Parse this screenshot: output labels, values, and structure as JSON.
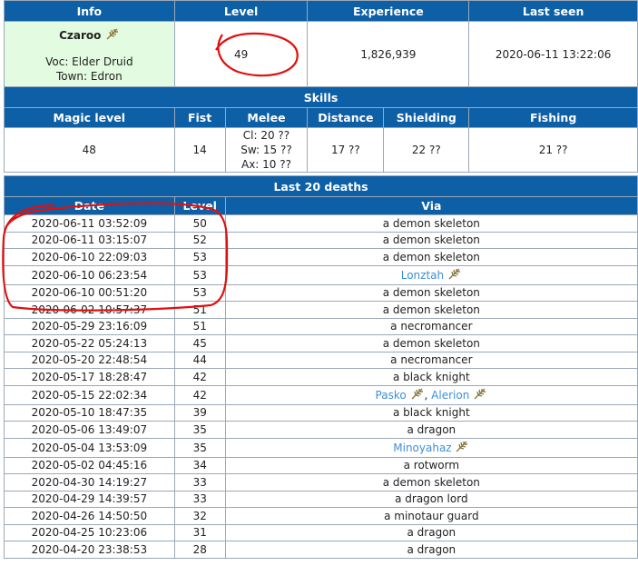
{
  "info": {
    "headers": [
      "Info",
      "Level",
      "Experience",
      "Last seen"
    ],
    "name": "Czaroo",
    "vocation": "Voc: Elder Druid",
    "town": "Town: Edron",
    "level": "49",
    "experience": "1,826,939",
    "last_seen": "2020-06-11 13:22:06"
  },
  "skills": {
    "title": "Skills",
    "headers": [
      "Magic level",
      "Fist",
      "Melee",
      "Distance",
      "Shielding",
      "Fishing"
    ],
    "magic": "48",
    "fist": "14",
    "melee_club": "Cl: 20 ??",
    "melee_sword": "Sw: 15 ??",
    "melee_axe": "Ax: 10 ??",
    "distance": "17 ??",
    "shielding": "22 ??",
    "fishing": "21 ??"
  },
  "deaths": {
    "title": "Last 20 deaths",
    "headers": [
      "Date",
      "Level",
      "Via"
    ],
    "rows": [
      {
        "date": "2020-06-11 03:52:09",
        "level": "50",
        "via": "a demon skeleton"
      },
      {
        "date": "2020-06-11 03:15:07",
        "level": "52",
        "via": "a demon skeleton"
      },
      {
        "date": "2020-06-10 22:09:03",
        "level": "53",
        "via": "a demon skeleton"
      },
      {
        "date": "2020-06-10 06:23:54",
        "level": "53",
        "via": "Lonztah"
      },
      {
        "date": "2020-06-10 00:51:20",
        "level": "53",
        "via": "a demon skeleton"
      },
      {
        "date": "2020-06-02 10:57:37",
        "level": "51",
        "via": "a demon skeleton"
      },
      {
        "date": "2020-05-29 23:16:09",
        "level": "51",
        "via": "a necromancer"
      },
      {
        "date": "2020-05-22 05:24:13",
        "level": "45",
        "via": "a demon skeleton"
      },
      {
        "date": "2020-05-20 22:48:54",
        "level": "44",
        "via": "a necromancer"
      },
      {
        "date": "2020-05-17 18:28:47",
        "level": "42",
        "via": "a black knight"
      },
      {
        "date": "2020-05-15 22:02:34",
        "level": "42",
        "via": "Pasko",
        "via2": "Alerion"
      },
      {
        "date": "2020-05-10 18:47:35",
        "level": "39",
        "via": "a black knight"
      },
      {
        "date": "2020-05-06 13:49:07",
        "level": "35",
        "via": "a dragon"
      },
      {
        "date": "2020-05-04 13:53:09",
        "level": "35",
        "via": "Minoyahaz"
      },
      {
        "date": "2020-05-02 04:45:16",
        "level": "34",
        "via": "a rotworm"
      },
      {
        "date": "2020-04-30 14:19:27",
        "level": "33",
        "via": "a demon skeleton"
      },
      {
        "date": "2020-04-29 14:39:57",
        "level": "33",
        "via": "a dragon lord"
      },
      {
        "date": "2020-04-26 14:50:50",
        "level": "32",
        "via": "a minotaur guard"
      },
      {
        "date": "2020-04-25 10:23:06",
        "level": "31",
        "via": "a dragon"
      },
      {
        "date": "2020-04-20 23:38:53",
        "level": "28",
        "via": "a dragon"
      }
    ]
  }
}
